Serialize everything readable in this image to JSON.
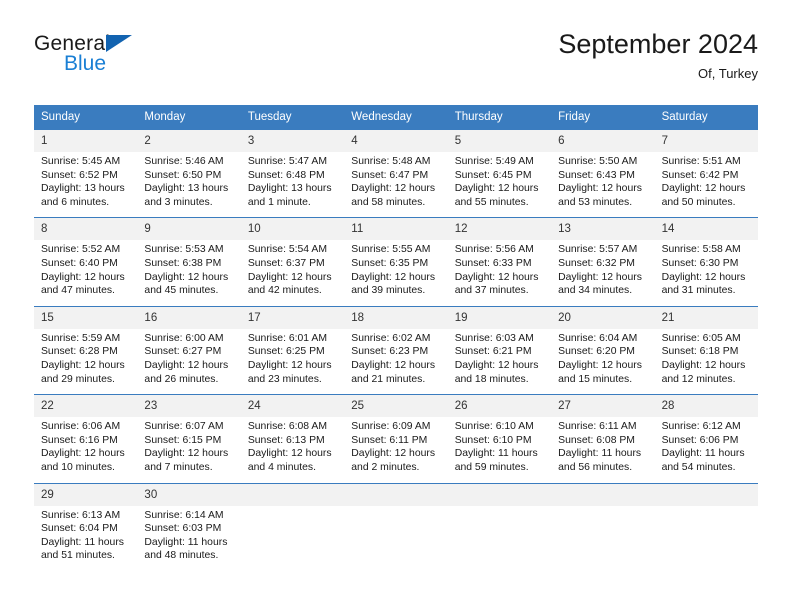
{
  "brand": {
    "name_part1": "General",
    "name_part2": "Blue",
    "triangle_color": "#1263b0",
    "blue_color": "#1a7fd4"
  },
  "header": {
    "title": "September 2024",
    "location": "Of, Turkey"
  },
  "theme": {
    "header_blue": "#3a7cbf",
    "daynum_background": "#f2f2f2",
    "cell_background": "#ffffff",
    "text_color": "#1a1a1a"
  },
  "weekdays": [
    "Sunday",
    "Monday",
    "Tuesday",
    "Wednesday",
    "Thursday",
    "Friday",
    "Saturday"
  ],
  "weeks": [
    [
      {
        "day": "1",
        "sunrise": "Sunrise: 5:45 AM",
        "sunset": "Sunset: 6:52 PM",
        "daylight": "Daylight: 13 hours and 6 minutes."
      },
      {
        "day": "2",
        "sunrise": "Sunrise: 5:46 AM",
        "sunset": "Sunset: 6:50 PM",
        "daylight": "Daylight: 13 hours and 3 minutes."
      },
      {
        "day": "3",
        "sunrise": "Sunrise: 5:47 AM",
        "sunset": "Sunset: 6:48 PM",
        "daylight": "Daylight: 13 hours and 1 minute."
      },
      {
        "day": "4",
        "sunrise": "Sunrise: 5:48 AM",
        "sunset": "Sunset: 6:47 PM",
        "daylight": "Daylight: 12 hours and 58 minutes."
      },
      {
        "day": "5",
        "sunrise": "Sunrise: 5:49 AM",
        "sunset": "Sunset: 6:45 PM",
        "daylight": "Daylight: 12 hours and 55 minutes."
      },
      {
        "day": "6",
        "sunrise": "Sunrise: 5:50 AM",
        "sunset": "Sunset: 6:43 PM",
        "daylight": "Daylight: 12 hours and 53 minutes."
      },
      {
        "day": "7",
        "sunrise": "Sunrise: 5:51 AM",
        "sunset": "Sunset: 6:42 PM",
        "daylight": "Daylight: 12 hours and 50 minutes."
      }
    ],
    [
      {
        "day": "8",
        "sunrise": "Sunrise: 5:52 AM",
        "sunset": "Sunset: 6:40 PM",
        "daylight": "Daylight: 12 hours and 47 minutes."
      },
      {
        "day": "9",
        "sunrise": "Sunrise: 5:53 AM",
        "sunset": "Sunset: 6:38 PM",
        "daylight": "Daylight: 12 hours and 45 minutes."
      },
      {
        "day": "10",
        "sunrise": "Sunrise: 5:54 AM",
        "sunset": "Sunset: 6:37 PM",
        "daylight": "Daylight: 12 hours and 42 minutes."
      },
      {
        "day": "11",
        "sunrise": "Sunrise: 5:55 AM",
        "sunset": "Sunset: 6:35 PM",
        "daylight": "Daylight: 12 hours and 39 minutes."
      },
      {
        "day": "12",
        "sunrise": "Sunrise: 5:56 AM",
        "sunset": "Sunset: 6:33 PM",
        "daylight": "Daylight: 12 hours and 37 minutes."
      },
      {
        "day": "13",
        "sunrise": "Sunrise: 5:57 AM",
        "sunset": "Sunset: 6:32 PM",
        "daylight": "Daylight: 12 hours and 34 minutes."
      },
      {
        "day": "14",
        "sunrise": "Sunrise: 5:58 AM",
        "sunset": "Sunset: 6:30 PM",
        "daylight": "Daylight: 12 hours and 31 minutes."
      }
    ],
    [
      {
        "day": "15",
        "sunrise": "Sunrise: 5:59 AM",
        "sunset": "Sunset: 6:28 PM",
        "daylight": "Daylight: 12 hours and 29 minutes."
      },
      {
        "day": "16",
        "sunrise": "Sunrise: 6:00 AM",
        "sunset": "Sunset: 6:27 PM",
        "daylight": "Daylight: 12 hours and 26 minutes."
      },
      {
        "day": "17",
        "sunrise": "Sunrise: 6:01 AM",
        "sunset": "Sunset: 6:25 PM",
        "daylight": "Daylight: 12 hours and 23 minutes."
      },
      {
        "day": "18",
        "sunrise": "Sunrise: 6:02 AM",
        "sunset": "Sunset: 6:23 PM",
        "daylight": "Daylight: 12 hours and 21 minutes."
      },
      {
        "day": "19",
        "sunrise": "Sunrise: 6:03 AM",
        "sunset": "Sunset: 6:21 PM",
        "daylight": "Daylight: 12 hours and 18 minutes."
      },
      {
        "day": "20",
        "sunrise": "Sunrise: 6:04 AM",
        "sunset": "Sunset: 6:20 PM",
        "daylight": "Daylight: 12 hours and 15 minutes."
      },
      {
        "day": "21",
        "sunrise": "Sunrise: 6:05 AM",
        "sunset": "Sunset: 6:18 PM",
        "daylight": "Daylight: 12 hours and 12 minutes."
      }
    ],
    [
      {
        "day": "22",
        "sunrise": "Sunrise: 6:06 AM",
        "sunset": "Sunset: 6:16 PM",
        "daylight": "Daylight: 12 hours and 10 minutes."
      },
      {
        "day": "23",
        "sunrise": "Sunrise: 6:07 AM",
        "sunset": "Sunset: 6:15 PM",
        "daylight": "Daylight: 12 hours and 7 minutes."
      },
      {
        "day": "24",
        "sunrise": "Sunrise: 6:08 AM",
        "sunset": "Sunset: 6:13 PM",
        "daylight": "Daylight: 12 hours and 4 minutes."
      },
      {
        "day": "25",
        "sunrise": "Sunrise: 6:09 AM",
        "sunset": "Sunset: 6:11 PM",
        "daylight": "Daylight: 12 hours and 2 minutes."
      },
      {
        "day": "26",
        "sunrise": "Sunrise: 6:10 AM",
        "sunset": "Sunset: 6:10 PM",
        "daylight": "Daylight: 11 hours and 59 minutes."
      },
      {
        "day": "27",
        "sunrise": "Sunrise: 6:11 AM",
        "sunset": "Sunset: 6:08 PM",
        "daylight": "Daylight: 11 hours and 56 minutes."
      },
      {
        "day": "28",
        "sunrise": "Sunrise: 6:12 AM",
        "sunset": "Sunset: 6:06 PM",
        "daylight": "Daylight: 11 hours and 54 minutes."
      }
    ],
    [
      {
        "day": "29",
        "sunrise": "Sunrise: 6:13 AM",
        "sunset": "Sunset: 6:04 PM",
        "daylight": "Daylight: 11 hours and 51 minutes."
      },
      {
        "day": "30",
        "sunrise": "Sunrise: 6:14 AM",
        "sunset": "Sunset: 6:03 PM",
        "daylight": "Daylight: 11 hours and 48 minutes."
      },
      {
        "day": "",
        "sunrise": "",
        "sunset": "",
        "daylight": ""
      },
      {
        "day": "",
        "sunrise": "",
        "sunset": "",
        "daylight": ""
      },
      {
        "day": "",
        "sunrise": "",
        "sunset": "",
        "daylight": ""
      },
      {
        "day": "",
        "sunrise": "",
        "sunset": "",
        "daylight": ""
      },
      {
        "day": "",
        "sunrise": "",
        "sunset": "",
        "daylight": ""
      }
    ]
  ]
}
